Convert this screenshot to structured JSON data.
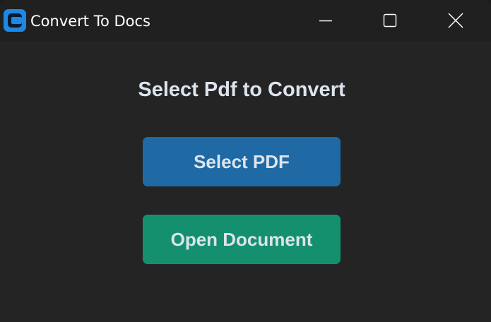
{
  "window": {
    "title": "Convert To Docs",
    "icon": "app-logo-icon",
    "controls": {
      "minimize": "minimize-icon",
      "maximize": "maximize-icon",
      "close": "close-icon"
    }
  },
  "main": {
    "heading": "Select Pdf to Convert",
    "select_pdf_label": "Select PDF",
    "open_document_label": "Open Document"
  },
  "colors": {
    "background": "#242424",
    "titlebar": "#202020",
    "text": "#dce4ee",
    "select_button": "#1f6aa5",
    "open_button": "#15906f",
    "app_icon": "#1e88e5"
  }
}
